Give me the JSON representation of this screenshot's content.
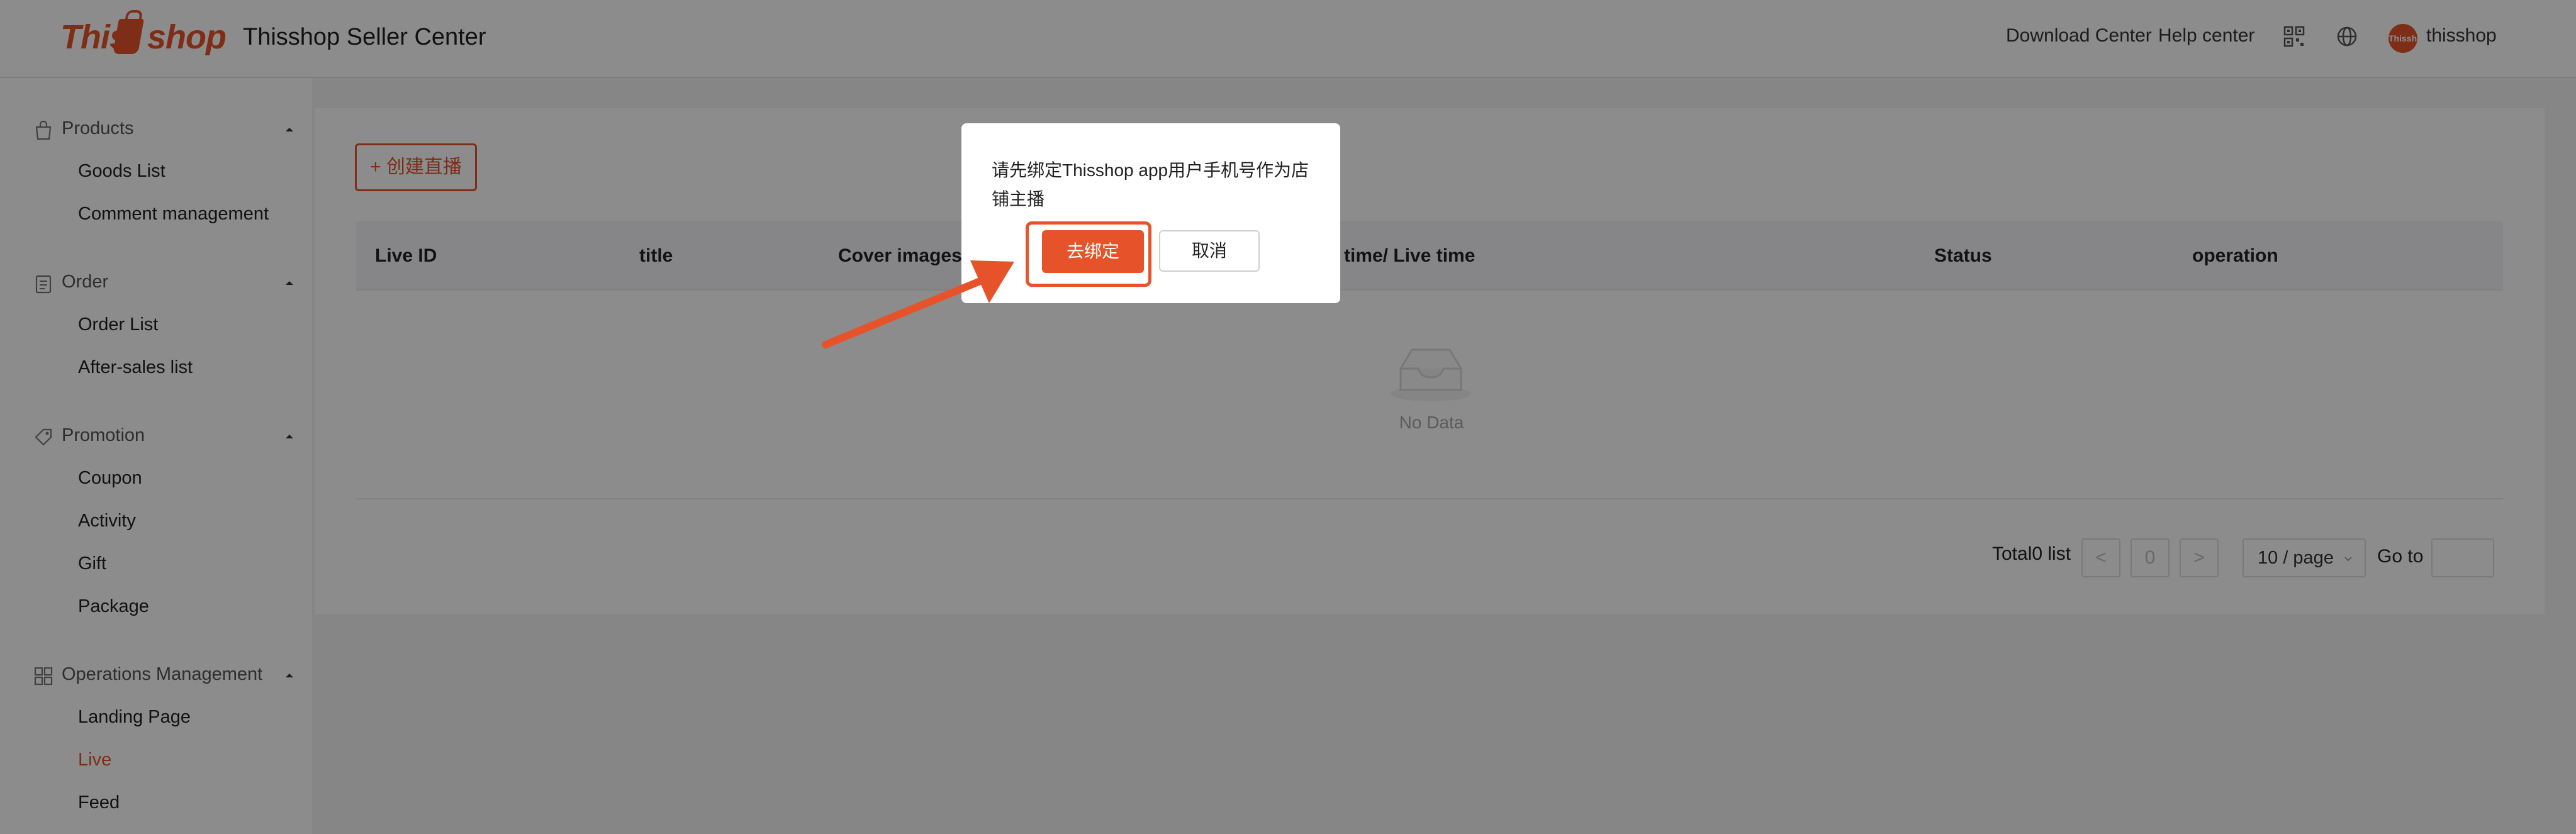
{
  "header": {
    "logo_this": "This",
    "logo_shop": "shop",
    "title": "Thisshop Seller Center",
    "download_center": "Download Center",
    "help_center": "Help center",
    "avatar_text": "Thisshop",
    "username": "thisshop"
  },
  "sidebar": {
    "groups": [
      {
        "label": "Products",
        "icon": "bag-icon",
        "items": [
          "Goods List",
          "Comment management"
        ]
      },
      {
        "label": "Order",
        "icon": "clipboard-icon",
        "items": [
          "Order List",
          "After-sales list"
        ]
      },
      {
        "label": "Promotion",
        "icon": "tag-icon",
        "items": [
          "Coupon",
          "Activity",
          "Gift",
          "Package"
        ]
      },
      {
        "label": "Operations Management",
        "icon": "grid-icon",
        "items": [
          "Landing Page",
          "Live",
          "Feed"
        ]
      }
    ],
    "active_item": "Live"
  },
  "main": {
    "create_button": "+ 创建直播",
    "columns": [
      "Live ID",
      "title",
      "Cover images",
      "time/ Live time",
      "Status",
      "operation"
    ],
    "empty_text": "No Data",
    "pagination": {
      "total": "Total0 list",
      "prev": "<",
      "current_page": "0",
      "next": ">",
      "page_size": "10 / page",
      "goto_label": "Go to",
      "goto_value": ""
    }
  },
  "dialog": {
    "message": "请先绑定Thisshop app用户手机号作为店铺主播",
    "confirm": "去绑定",
    "cancel": "取消"
  },
  "colors": {
    "accent": "#e6532a",
    "overlay": "rgba(0,0,0,0.45)"
  }
}
